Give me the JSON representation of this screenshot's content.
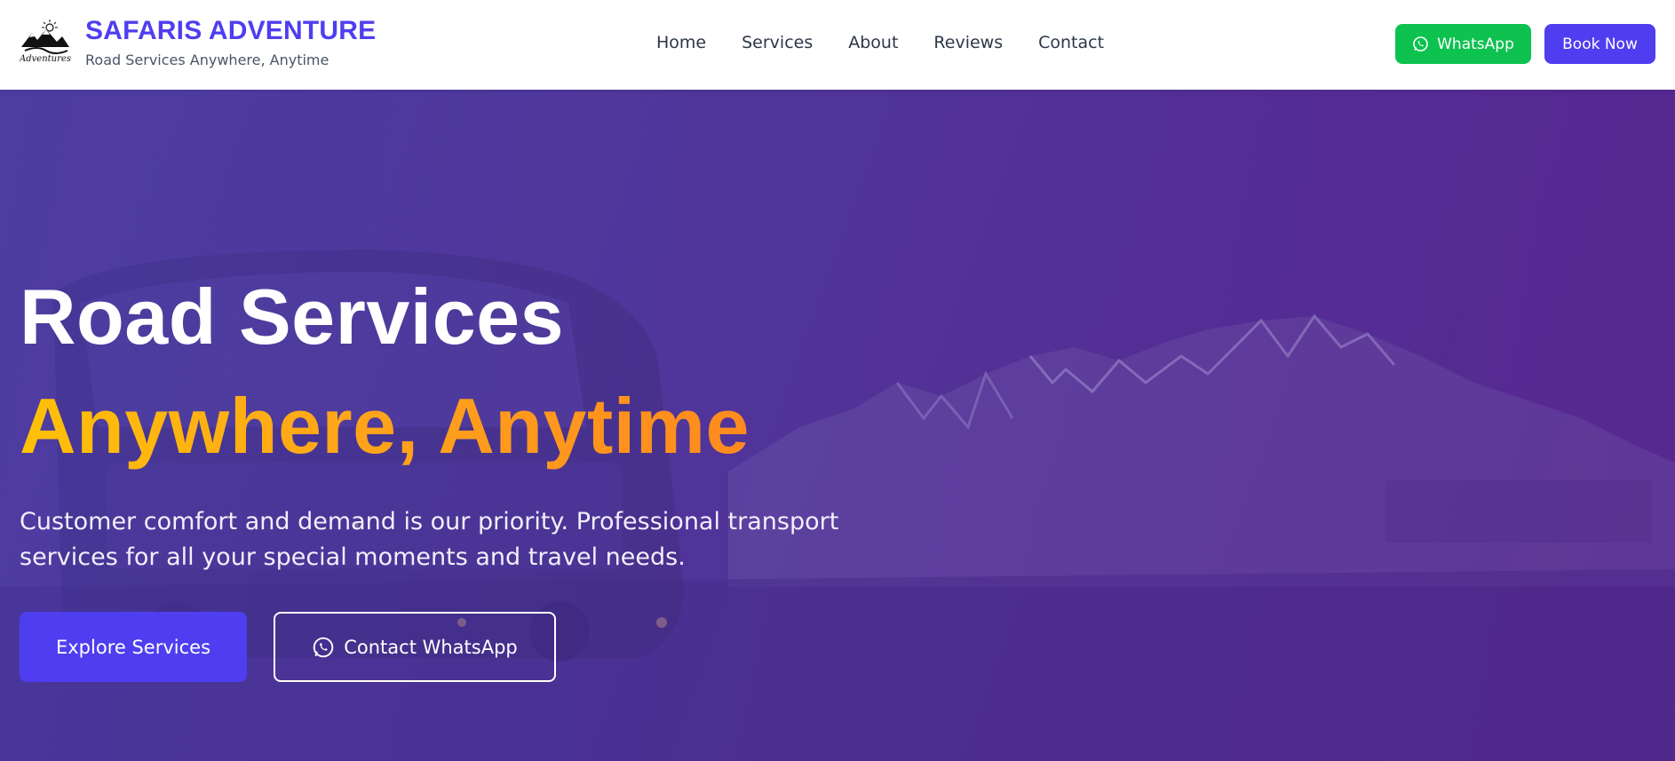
{
  "header": {
    "brand_title": "SAFARIS ADVENTURE",
    "brand_tagline": "Road Services Anywhere, Anytime",
    "logo_icon": "mountain-logo-icon",
    "nav": [
      {
        "label": "Home"
      },
      {
        "label": "Services"
      },
      {
        "label": "About"
      },
      {
        "label": "Reviews"
      },
      {
        "label": "Contact"
      }
    ],
    "whatsapp_label": "WhatsApp",
    "book_label": "Book Now"
  },
  "hero": {
    "title_line1": "Road Services",
    "title_line2": "Anywhere, Anytime",
    "description": "Customer comfort and demand is our priority. Professional transport services for all your special moments and travel needs.",
    "explore_label": "Explore Services",
    "contact_label": "Contact WhatsApp"
  },
  "colors": {
    "brand": "#4f3ef0",
    "whatsapp": "#0dc24f",
    "accent_gradient_start": "#ffc107",
    "accent_gradient_end": "#ff8a1f",
    "hero_overlay": "#4a3596"
  }
}
